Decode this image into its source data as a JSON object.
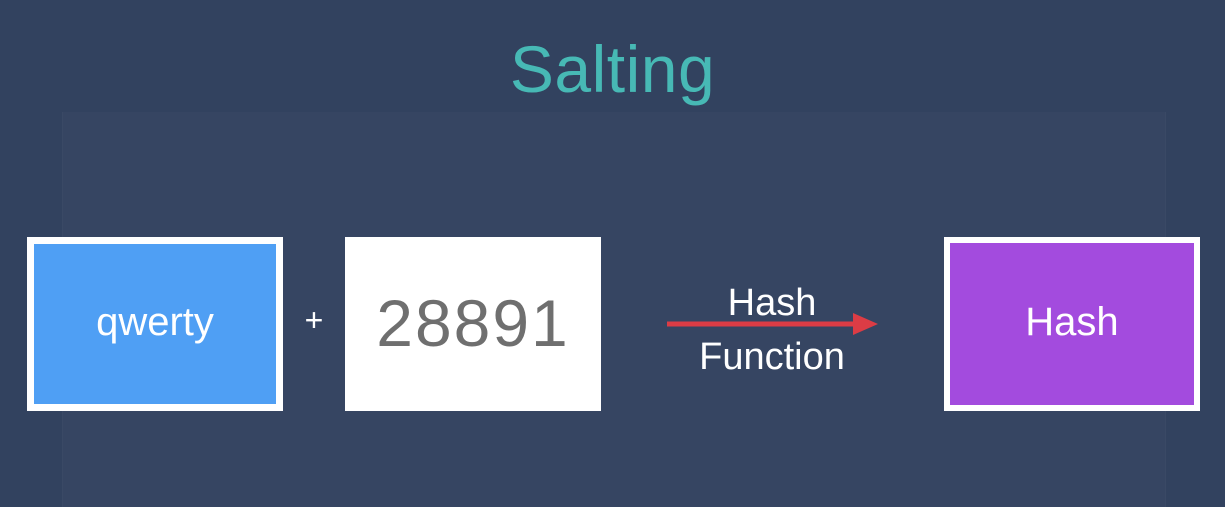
{
  "title": "Salting",
  "diagram": {
    "input": {
      "label": "qwerty",
      "color": "#4f9ff4"
    },
    "operator": "+",
    "salt": {
      "label": "28891"
    },
    "function": {
      "line1": "Hash",
      "line2": "Function",
      "arrow_color": "#dc3c45"
    },
    "output": {
      "label": "Hash",
      "color": "#a34bde"
    }
  },
  "colors": {
    "background": "#32425f",
    "title": "#47b9b5"
  }
}
